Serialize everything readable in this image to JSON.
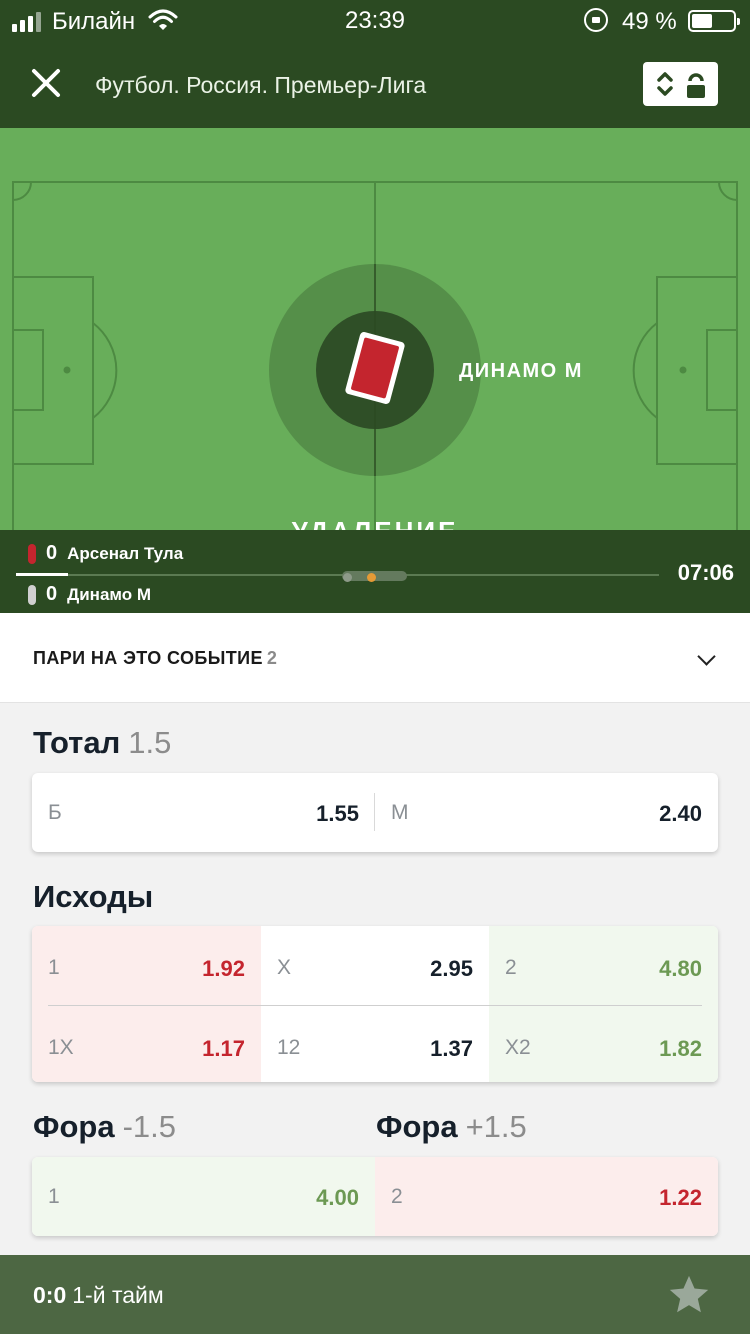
{
  "status_bar": {
    "carrier": "Билайн",
    "time": "23:39",
    "battery": "49 %"
  },
  "header": {
    "title": "Футбол. Россия. Премьер-Лига",
    "close_icon": "close-icon",
    "tool_icon": "sort-toggle-icon"
  },
  "field": {
    "event_team": "ДИНАМО М",
    "event_caption": "УДАЛЕНИЕ",
    "event_icon": "red-card-icon"
  },
  "scoreboard": {
    "teams": [
      {
        "score": "0",
        "name": "Арсенал Тула",
        "card_color": "#c4252e"
      },
      {
        "score": "0",
        "name": "Динамо М",
        "card_color": "#d0d0d0"
      }
    ],
    "match_time": "07:06"
  },
  "bets_on_event": {
    "title": "ПАРИ НА ЭТО СОБЫТИЕ",
    "count": "2"
  },
  "markets": {
    "total": {
      "title": "Тотал",
      "line": "1.5",
      "odds": [
        {
          "label": "Б",
          "value": "1.55"
        },
        {
          "label": "М",
          "value": "2.40"
        }
      ]
    },
    "outcomes": {
      "title": "Исходы",
      "odds": [
        {
          "label": "1",
          "value": "1.92",
          "trend": "down"
        },
        {
          "label": "X",
          "value": "2.95",
          "trend": "none"
        },
        {
          "label": "2",
          "value": "4.80",
          "trend": "up"
        },
        {
          "label": "1X",
          "value": "1.17",
          "trend": "down"
        },
        {
          "label": "12",
          "value": "1.37",
          "trend": "none"
        },
        {
          "label": "X2",
          "value": "1.82",
          "trend": "up"
        }
      ]
    },
    "handicap_1": {
      "title": "Фора",
      "line": "-1.5",
      "odd": {
        "label": "1",
        "value": "4.00",
        "trend": "up"
      }
    },
    "handicap_2": {
      "title": "Фора",
      "line": "+1.5",
      "odd": {
        "label": "2",
        "value": "1.22",
        "trend": "down"
      }
    }
  },
  "bottom_bar": {
    "score": "0:0",
    "period": "1-й тайм",
    "star_icon": "star-icon"
  },
  "colors": {
    "header_bg": "#2b4a22",
    "field_green": "#68ae5a",
    "odd_down": "#c4252e",
    "odd_up": "#6c9953",
    "bottom_bar_bg": "#4d6743"
  }
}
